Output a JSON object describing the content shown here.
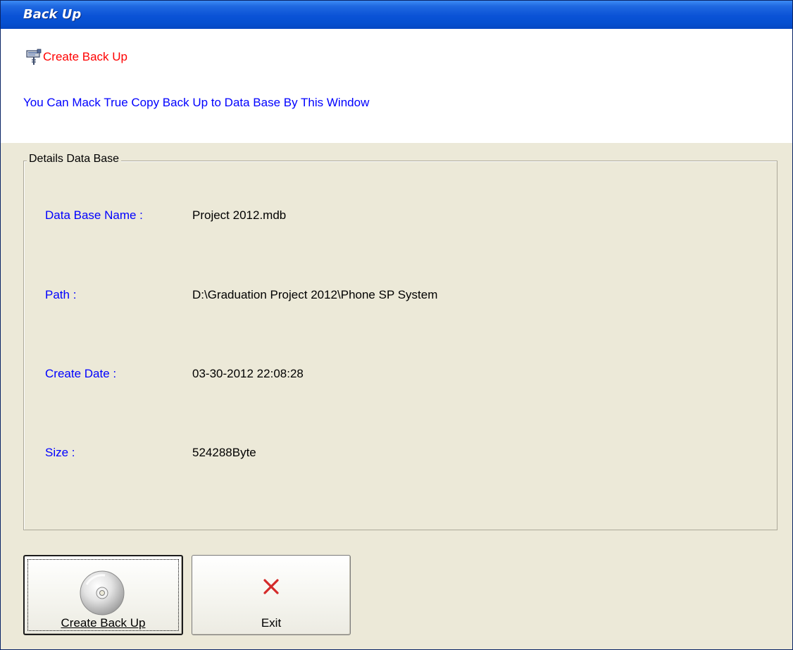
{
  "window": {
    "title": "Back Up"
  },
  "header": {
    "icon": "backup-tool-icon",
    "title": "Create Back Up",
    "description": "You Can Mack True Copy Back Up to Data Base By This Window"
  },
  "details": {
    "group_label": "Details Data Base",
    "fields": [
      {
        "label": "Data Base Name :",
        "value": "Project 2012.mdb"
      },
      {
        "label": "Path :",
        "value": "D:\\Graduation Project 2012\\Phone SP System"
      },
      {
        "label": "Create Date :",
        "value": "03-30-2012 22:08:28"
      },
      {
        "label": "Size :",
        "value": "524288Byte"
      }
    ]
  },
  "buttons": {
    "create_backup": {
      "label": "Create Back Up",
      "icon": "cd-disc-icon"
    },
    "exit": {
      "label": "Exit",
      "icon": "close-x-icon"
    }
  },
  "colors": {
    "title_bar": "#0a52d6",
    "header_title": "#ff0000",
    "description_text": "#0000ff",
    "field_label": "#0000ff",
    "dialog_background": "#ece9d8",
    "exit_icon": "#d42a2a"
  }
}
